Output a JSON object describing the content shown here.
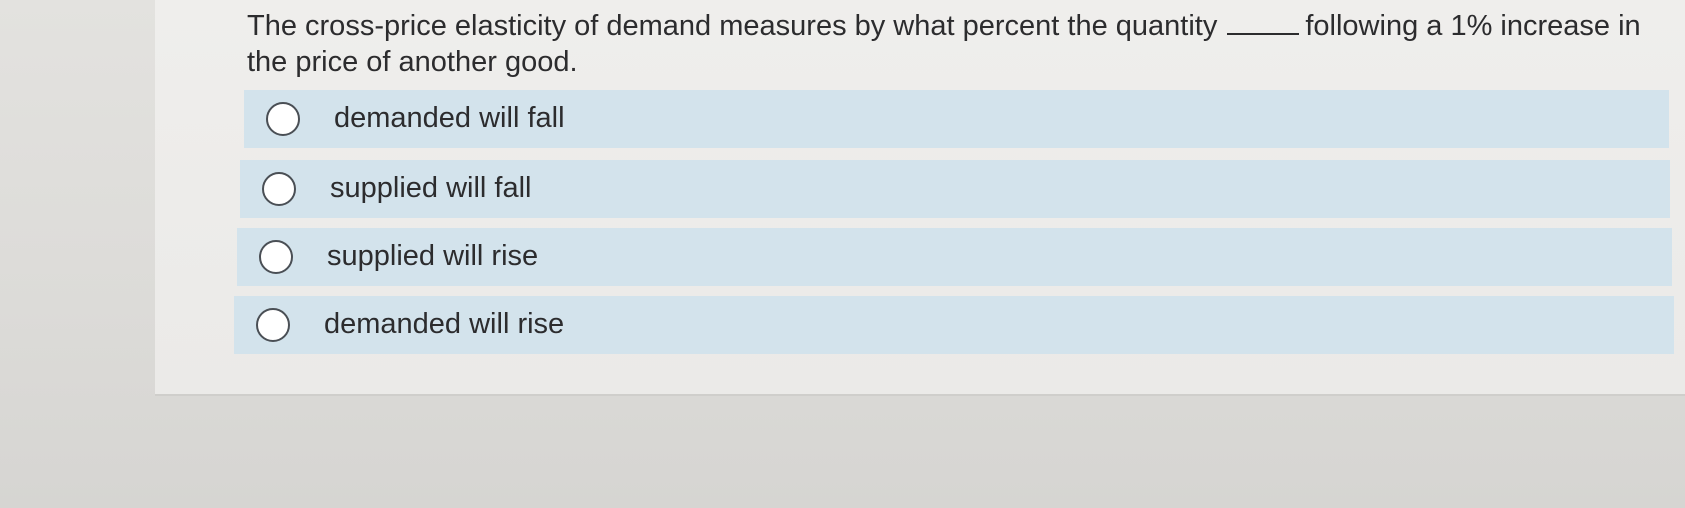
{
  "question": {
    "text_before_blank": "The cross-price elasticity of demand measures by what percent the quantity",
    "text_after_blank": "following a 1% increase in the price of another good."
  },
  "options": [
    {
      "label": "demanded will fall",
      "selected": false
    },
    {
      "label": "supplied will fall",
      "selected": false
    },
    {
      "label": "supplied will rise",
      "selected": false
    },
    {
      "label": "demanded will rise",
      "selected": false
    }
  ],
  "colors": {
    "option_background": "#d3e3ec",
    "card_background": "#efeeec",
    "text": "#2c2c2e"
  }
}
